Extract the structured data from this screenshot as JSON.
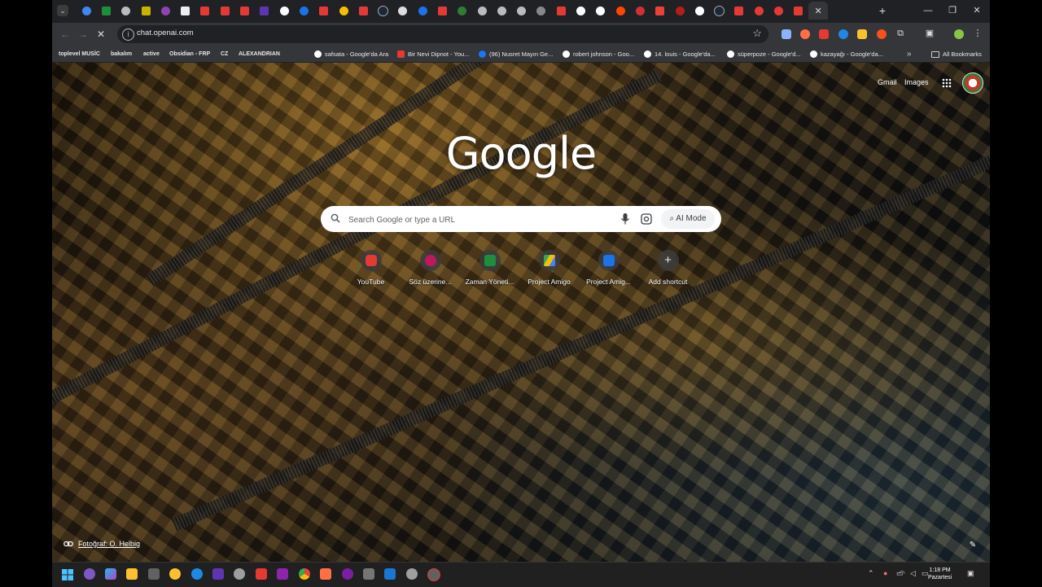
{
  "browser": {
    "tab_favicons": [
      "gem-icon",
      "sheets-icon",
      "chatgpt-icon",
      "bold-b-icon",
      "crystal-icon",
      "notion-icon",
      "youtube-icon",
      "youtube-icon",
      "youtube-icon",
      "tasks-icon",
      "google-icon",
      "planner-icon",
      "youtube-icon",
      "drive-icon",
      "youtube-icon",
      "steam-icon",
      "github-icon",
      "planner-icon",
      "youtube-icon",
      "cursor-icon",
      "chatgpt-icon",
      "chatgpt-icon",
      "chatgpt-icon",
      "openai-icon",
      "youtube-icon",
      "google-icon",
      "google-icon",
      "reddit-icon",
      "opera-icon",
      "gmail-icon",
      "target-icon",
      "google-icon",
      "steam-icon",
      "youtube-icon",
      "youtube-icon",
      "youtube-icon",
      "youtube-icon"
    ],
    "address_bar": {
      "url": "chat.openai.com"
    },
    "bookmarks": {
      "folders": [
        "toplevel MUSİC",
        "bakalım",
        "active",
        "Obsidian - FRP",
        "CZ",
        "ALEXANDRIAN"
      ],
      "links": [
        "safsata - Google'da Ara",
        "Bir Nevi Dipnot - You...",
        "(96) Nusret Mayın Ge...",
        "robert johnson - Goo...",
        "14. louis - Google'da...",
        "süperpoze - Google'd...",
        "kazayağı - Google'da..."
      ],
      "overflow": "»",
      "all_bookmarks": "All Bookmarks"
    }
  },
  "ntp": {
    "header": {
      "gmail": "Gmail",
      "images": "Images"
    },
    "logo": "Google",
    "search": {
      "placeholder": "Search Google or type a URL",
      "ai_mode": "AI Mode"
    },
    "shortcuts": [
      {
        "label": "YouTube",
        "icon": "youtube-icon",
        "color": "#e53935"
      },
      {
        "label": "Söz üzerine...",
        "icon": "s-letter-icon",
        "color": "#c2185b"
      },
      {
        "label": "Zaman Yöneti...",
        "icon": "sheets-icon",
        "color": "#1e8e3e"
      },
      {
        "label": "Project Amigo",
        "icon": "drive-icon",
        "color": "#fbbc04"
      },
      {
        "label": "Project Amig...",
        "icon": "planner-icon",
        "color": "#1a73e8"
      },
      {
        "label": "Add shortcut",
        "icon": "plus-icon",
        "color": "#e3e3e3"
      }
    ],
    "photo_credit": "Fotoğraf: O. Helbig"
  },
  "taskbar": {
    "clock_time": "1:18 PM",
    "clock_day": "Pazartesi"
  },
  "colors": {
    "frame": "#202124",
    "toolbar": "#35363a",
    "accent": "#8ab4f8"
  }
}
